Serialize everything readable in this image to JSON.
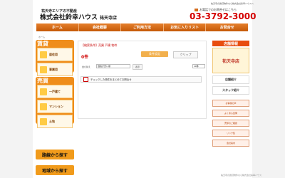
{
  "header": {
    "top_note": "祐天寺の賃貸物件なら株式会社鈴幸ハウスへ",
    "tagline": "祐天寺エリアの不動産",
    "company": "株式会社鈴幸ハウス",
    "branch": "祐天寺店",
    "phone_note": "お電話でのお問合せはこちら",
    "phone": "03-3792-3000"
  },
  "nav": [
    "ホーム",
    "会社概要",
    "ご利用方法",
    "お気に入りリスト",
    "お問合せ"
  ],
  "breadcrumb": "ホーム",
  "sidebar": {
    "rent_title": "賃貸",
    "rent_items": [
      "居住用",
      "事業用"
    ],
    "sale_title": "売買",
    "sale_items": [
      "一戸建て",
      "マンション",
      "土地"
    ],
    "route_search": "路線から探す",
    "area_search": "地域から探す"
  },
  "main": {
    "search_condition": "【検索条件】売買 戸建 物件",
    "count": "0件",
    "condition_button": "条件設定",
    "clip_button": "クリップ",
    "sort_label": "並び替え",
    "sort_value": "価格が安い順",
    "sort_action": "表示",
    "perpage": "10件",
    "checked_label": "チェックした物件をまとめてお問合せ"
  },
  "right": {
    "head": "店舗情報",
    "store_name": "祐天寺店",
    "store_info": "店舗紹介",
    "staff": "スタッフ紹介",
    "banners": [
      "お客様の声",
      "よくある質問",
      "売却のご相談",
      "リンク集",
      "会社案内"
    ]
  },
  "footer": "祐天寺の賃貸物件なら株式会社鈴幸ハウス"
}
